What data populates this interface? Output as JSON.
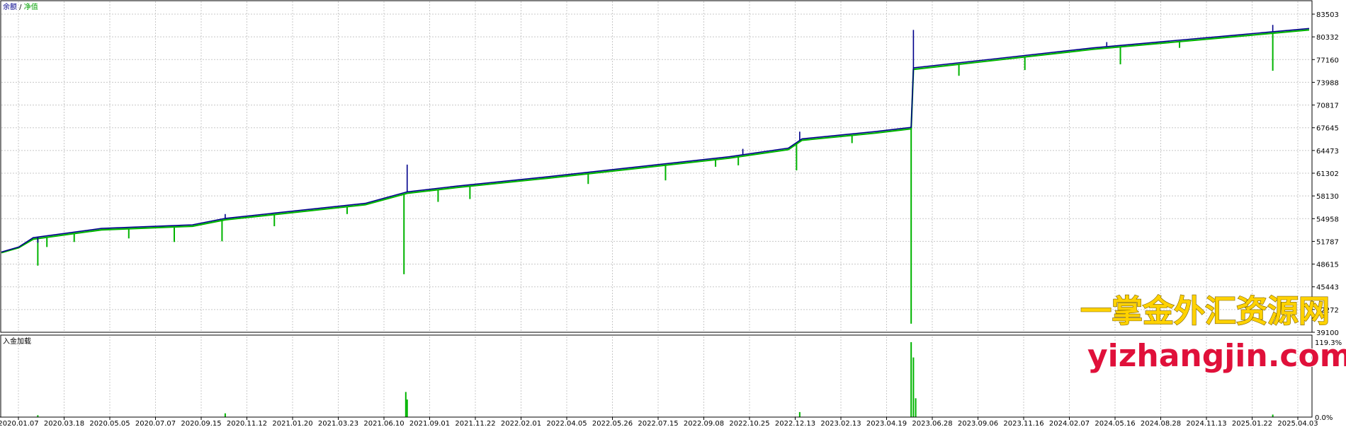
{
  "legend": {
    "balance_label": "余额",
    "separator": " / ",
    "equity_label": "净值"
  },
  "deposit_panel_label": "入金加载",
  "colors": {
    "balance": "#00008b",
    "equity": "#00b400",
    "load": "#00b400",
    "grid": "#c8c8c8",
    "frame": "#000000"
  },
  "watermark": {
    "line1": "一掌金外汇资源网",
    "line2": "yizhangjin.com"
  },
  "chart_data": [
    {
      "type": "line",
      "title": "",
      "y_ticks": [
        "83503",
        "80332",
        "77160",
        "73988",
        "70817",
        "67645",
        "64473",
        "61302",
        "58130",
        "54958",
        "51787",
        "48615",
        "45443",
        "42272",
        "39100"
      ],
      "ylim": [
        39100,
        83503
      ],
      "x_tick_labels": [
        "2020.01.07",
        "2020.03.18",
        "2020.05.05",
        "2020.07.07",
        "2020.09.15",
        "2020.11.12",
        "2021.01.20",
        "2021.03.23",
        "2021.06.10",
        "2021.09.01",
        "2021.11.22",
        "2022.02.01",
        "2022.04.05",
        "2022.05.26",
        "2022.07.15",
        "2022.09.08",
        "2022.10.25",
        "2022.12.13",
        "2023.02.13",
        "2023.04.19",
        "2023.06.28",
        "2023.09.06",
        "2023.11.16",
        "2024.02.07",
        "2024.05.16",
        "2024.08.28",
        "2024.11.13",
        "2025.01.22",
        "2025.04.03"
      ],
      "series": [
        {
          "name": "余额",
          "points": [
            [
              0,
              50300
            ],
            [
              0.38,
              51000
            ],
            [
              0.7,
              52300
            ],
            [
              2.2,
              53600
            ],
            [
              4.2,
              54100
            ],
            [
              4.92,
              55000
            ],
            [
              8.0,
              57100
            ],
            [
              8.92,
              58700
            ],
            [
              10.0,
              59500
            ],
            [
              12.0,
              60800
            ],
            [
              16.0,
              63600
            ],
            [
              17.3,
              64800
            ],
            [
              17.6,
              66100
            ],
            [
              19.2,
              67100
            ],
            [
              20.0,
              67700
            ],
            [
              20.05,
              76000
            ],
            [
              24.0,
              78800
            ],
            [
              27.0,
              80500
            ],
            [
              28.75,
              81500
            ]
          ],
          "spikes": [
            [
              0.8,
              51600
            ],
            [
              4.92,
              55600
            ],
            [
              8.92,
              62500
            ],
            [
              16.3,
              64700
            ],
            [
              17.55,
              67100
            ],
            [
              20.05,
              81300
            ],
            [
              24.3,
              79600
            ],
            [
              27.95,
              82000
            ]
          ]
        },
        {
          "name": "净值",
          "points": [
            [
              0,
              50200
            ],
            [
              0.38,
              50900
            ],
            [
              0.7,
              52100
            ],
            [
              2.2,
              53400
            ],
            [
              4.2,
              53900
            ],
            [
              4.92,
              54800
            ],
            [
              8.0,
              56900
            ],
            [
              8.92,
              58500
            ],
            [
              10.0,
              59300
            ],
            [
              12.0,
              60600
            ],
            [
              16.0,
              63400
            ],
            [
              17.3,
              64600
            ],
            [
              17.6,
              65900
            ],
            [
              19.2,
              66900
            ],
            [
              20.0,
              67500
            ],
            [
              20.05,
              75800
            ],
            [
              24.0,
              78600
            ],
            [
              27.0,
              80300
            ],
            [
              28.75,
              81300
            ]
          ],
          "dips": [
            [
              0.8,
              48400
            ],
            [
              1.0,
              51000
            ],
            [
              1.6,
              51700
            ],
            [
              2.8,
              52200
            ],
            [
              3.8,
              51700
            ],
            [
              4.85,
              51800
            ],
            [
              6.0,
              53900
            ],
            [
              7.6,
              55600
            ],
            [
              8.85,
              47200
            ],
            [
              9.6,
              57300
            ],
            [
              10.3,
              57700
            ],
            [
              12.9,
              59800
            ],
            [
              14.6,
              60300
            ],
            [
              15.7,
              62200
            ],
            [
              16.2,
              62400
            ],
            [
              17.48,
              61700
            ],
            [
              18.7,
              65500
            ],
            [
              20.0,
              40300
            ],
            [
              21.05,
              74900
            ],
            [
              22.5,
              75700
            ],
            [
              24.6,
              76500
            ],
            [
              25.9,
              78800
            ],
            [
              27.95,
              75600
            ]
          ]
        }
      ]
    },
    {
      "type": "area",
      "title": "入金加载",
      "y_ticks": [
        "119.3%",
        "0.0%"
      ],
      "ylim": [
        0,
        119.3
      ],
      "values": [
        [
          0.8,
          3
        ],
        [
          4.92,
          6
        ],
        [
          8.89,
          40
        ],
        [
          8.92,
          28
        ],
        [
          17.55,
          8
        ],
        [
          20.0,
          119.3
        ],
        [
          20.05,
          95
        ],
        [
          20.1,
          30
        ],
        [
          27.95,
          4
        ]
      ]
    }
  ]
}
